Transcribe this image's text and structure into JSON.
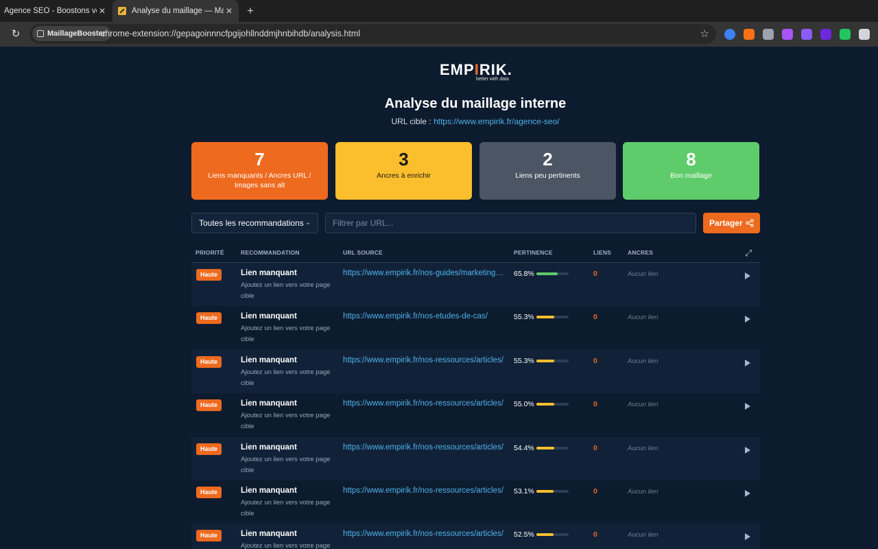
{
  "browser": {
    "tabs": [
      {
        "title": "Agence SEO - Boostons votre B",
        "active": false
      },
      {
        "title": "Analyse du maillage — Maillage",
        "active": true
      }
    ],
    "new_tab": "+",
    "close_glyph": "✕",
    "extension_chip": "MaillageBooster",
    "url": "chrome-extension://gepagoinnncfpgijohllnddmjhnbihdb/analysis.html",
    "extension_icon_colors": [
      "#3b82f6",
      "#f97316",
      "#9ca3af",
      "#a855f7",
      "#8b5cf6",
      "#6d28d9",
      "#22c55e",
      "#d1d5db"
    ]
  },
  "header": {
    "logo_text_before": "EMP",
    "logo_text_mark": "I",
    "logo_text_after": "RIK.",
    "logo_tagline": "better with data",
    "title": "Analyse du maillage interne",
    "subtitle_label": "URL cible :",
    "subtitle_url": "https://www.empirik.fr/agence-seo/"
  },
  "cards": [
    {
      "value": "7",
      "label": "Liens manquants / Ancres URL / Images sans alt",
      "color": "#ee6a1f"
    },
    {
      "value": "3",
      "label": "Ancres à enrichir",
      "color": "#fbbf2d"
    },
    {
      "value": "2",
      "label": "Liens peu pertinents",
      "color": "#4b5563"
    },
    {
      "value": "8",
      "label": "Bon maillage",
      "color": "#5fcc6b"
    }
  ],
  "filters": {
    "select_value": "Toutes les recommandations",
    "filter_placeholder": "Filtrer par URL...",
    "share_label": "Partager"
  },
  "table": {
    "headers": {
      "priority": "PRIORITÉ",
      "recommendation": "RECOMMANDATION",
      "source": "URL SOURCE",
      "relevance": "PERTINENCE",
      "links": "LIENS",
      "anchors": "ANCRES"
    },
    "rows": [
      {
        "priority": "Haute",
        "title": "Lien manquant",
        "desc": "Ajoutez un lien vers votre page cible",
        "url": "https://www.empirik.fr/nos-guides/marketing-digital/",
        "relevance": "65.8%",
        "relevance_value": 65.8,
        "bar_color": "#5fcc6b",
        "links": "0",
        "anchors": "Aucun lien"
      },
      {
        "priority": "Haute",
        "title": "Lien manquant",
        "desc": "Ajoutez un lien vers votre page cible",
        "url": "https://www.empirik.fr/nos-etudes-de-cas/",
        "relevance": "55.3%",
        "relevance_value": 55.3,
        "bar_color": "#fbbf2d",
        "links": "0",
        "anchors": "Aucun lien"
      },
      {
        "priority": "Haute",
        "title": "Lien manquant",
        "desc": "Ajoutez un lien vers votre page cible",
        "url": "https://www.empirik.fr/nos-ressources/articles/",
        "relevance": "55.3%",
        "relevance_value": 55.3,
        "bar_color": "#fbbf2d",
        "links": "0",
        "anchors": "Aucun lien"
      },
      {
        "priority": "Haute",
        "title": "Lien manquant",
        "desc": "Ajoutez un lien vers votre page cible",
        "url": "https://www.empirik.fr/nos-ressources/articles/",
        "relevance": "55.0%",
        "relevance_value": 55.0,
        "bar_color": "#fbbf2d",
        "links": "0",
        "anchors": "Aucun lien"
      },
      {
        "priority": "Haute",
        "title": "Lien manquant",
        "desc": "Ajoutez un lien vers votre page cible",
        "url": "https://www.empirik.fr/nos-ressources/articles/",
        "relevance": "54.4%",
        "relevance_value": 54.4,
        "bar_color": "#fbbf2d",
        "links": "0",
        "anchors": "Aucun lien"
      },
      {
        "priority": "Haute",
        "title": "Lien manquant",
        "desc": "Ajoutez un lien vers votre page cible",
        "url": "https://www.empirik.fr/nos-ressources/articles/",
        "relevance": "53.1%",
        "relevance_value": 53.1,
        "bar_color": "#fbbf2d",
        "links": "0",
        "anchors": "Aucun lien"
      },
      {
        "priority": "Haute",
        "title": "Lien manquant",
        "desc": "Ajoutez un lien vers votre page cible",
        "url": "https://www.empirik.fr/nos-ressources/articles/",
        "relevance": "52.5%",
        "relevance_value": 52.5,
        "bar_color": "#fbbf2d",
        "links": "0",
        "anchors": "Aucun lien"
      }
    ]
  }
}
